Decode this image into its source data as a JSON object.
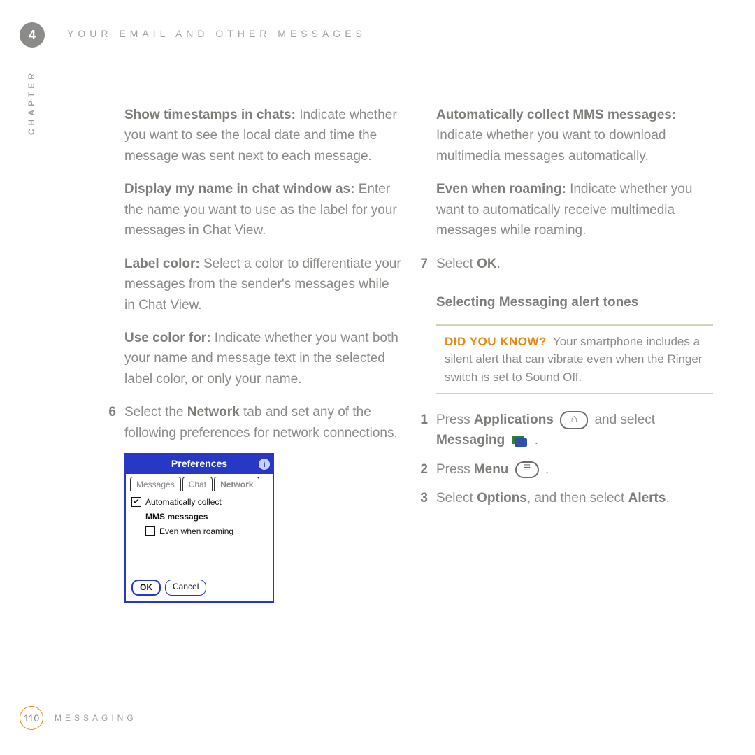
{
  "chapter_badge": "4",
  "running_head": "YOUR EMAIL AND OTHER MESSAGES",
  "side_label": "CHAPTER",
  "left": {
    "defs": [
      {
        "term": "Show timestamps in chats:",
        "body": " Indicate whether you want to see the local date and time the message was sent next to each message."
      },
      {
        "term": "Display my name in chat window as:",
        "body": " Enter the name you want to use as the label for your messages in Chat View."
      },
      {
        "term": "Label color:",
        "body": " Select a color to differentiate your messages from the sender's messages while in Chat View."
      },
      {
        "term": "Use color for:",
        "body": " Indicate whether you want both your name and message text in the selected label color, or only your name."
      }
    ],
    "step6_num": "6",
    "step6_a": "Select the ",
    "step6_b": "Network",
    "step6_c": " tab and set any of the following preferences for network connections."
  },
  "palm": {
    "title": "Preferences",
    "info": "i",
    "tabs": [
      "Messages",
      "Chat",
      "Network"
    ],
    "active_tab_index": 2,
    "opt1_label": "Automatically collect",
    "opt1_sub": "MMS messages",
    "opt1_checked": true,
    "opt2_label": "Even when roaming",
    "opt2_checked": false,
    "ok": "OK",
    "cancel": "Cancel"
  },
  "right": {
    "defs": [
      {
        "term": "Automatically collect MMS messages:",
        "body": " Indicate whether you want to download multimedia messages automatically."
      },
      {
        "term": "Even when roaming:",
        "body": " Indicate whether you want to automatically receive multimedia messages while roaming."
      }
    ],
    "step7_num": "7",
    "step7_a": "Select ",
    "step7_b": "OK",
    "step7_c": ".",
    "subhead": "Selecting Messaging alert tones",
    "tip_lead": "DID YOU KNOW",
    "tip_q": "?",
    "tip_body": "Your smartphone includes a silent alert that can vibrate even when the Ringer switch is set to Sound Off.",
    "s1_num": "1",
    "s1_a": "Press ",
    "s1_b": "Applications",
    "s1_c": " and select ",
    "s1_d": "Messaging",
    "s1_e": " .",
    "s2_num": "2",
    "s2_a": "Press ",
    "s2_b": "Menu",
    "s2_c": " .",
    "s3_num": "3",
    "s3_a": "Select ",
    "s3_b": "Options",
    "s3_c": ", and then select ",
    "s3_d": "Alerts",
    "s3_e": "."
  },
  "footer": {
    "page": "110",
    "section": "MESSAGING"
  }
}
